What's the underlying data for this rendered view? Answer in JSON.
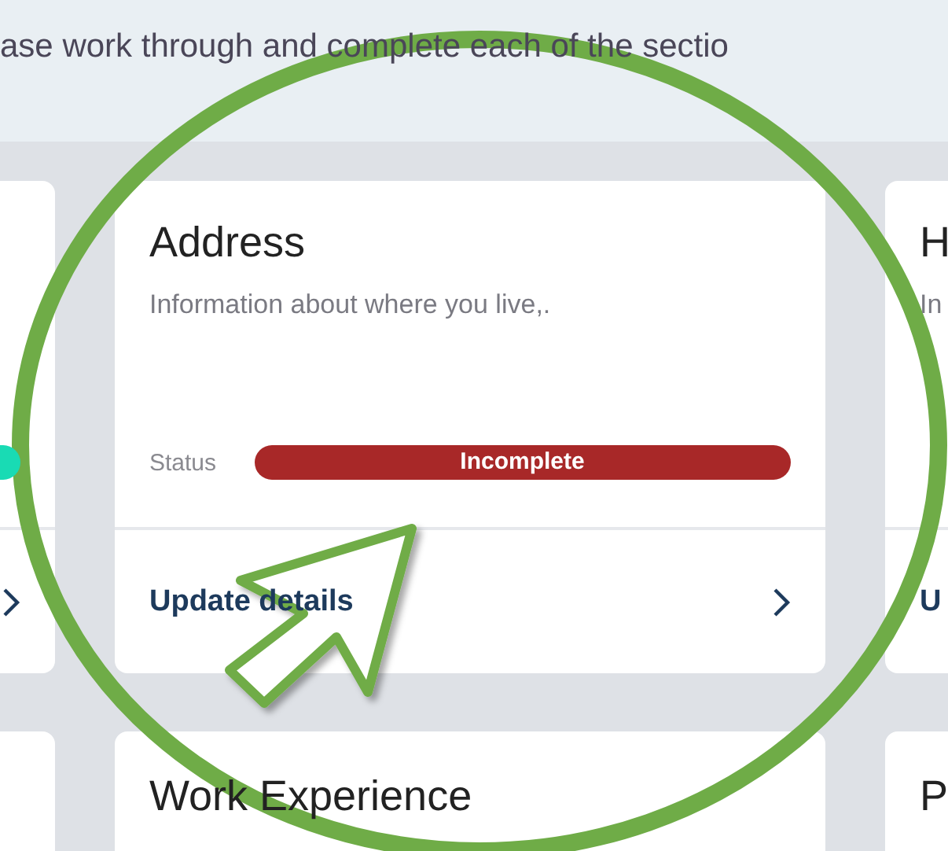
{
  "intro": "ase work through and complete each of the sectio",
  "cards": [
    {
      "color": "#19dbb4"
    },
    {
      "title": "Address",
      "description": "Information about where you live,.",
      "status_label": "Status",
      "status": "Incomplete",
      "color": "#a82828",
      "action": "Update details"
    },
    {
      "title": "H",
      "description": "In",
      "action": "U"
    }
  ],
  "next_cards": [
    {
      "title": "Work Experience"
    },
    {
      "title": "P"
    }
  ]
}
